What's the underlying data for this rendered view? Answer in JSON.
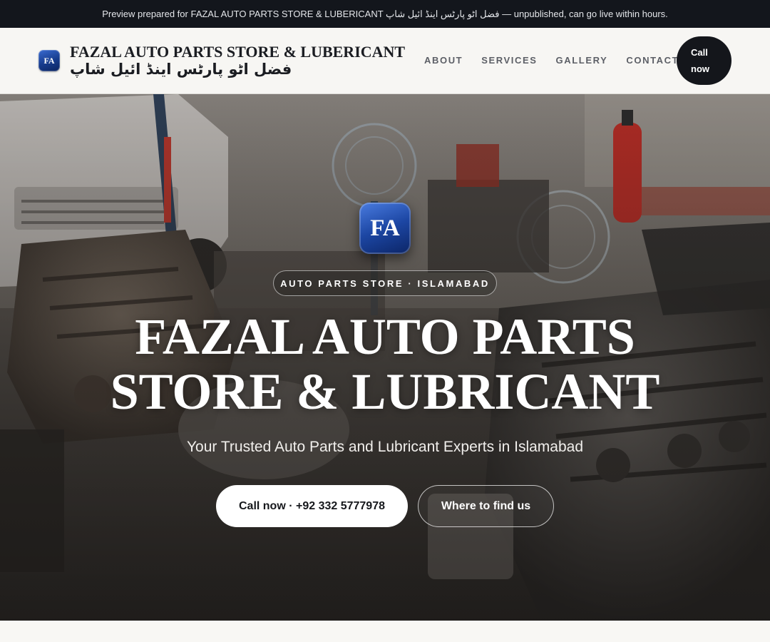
{
  "preview_banner": {
    "text": "Preview prepared for FAZAL AUTO PARTS STORE & LUBERICANT فضل اٹو پارٹس اینڈ ائیل شاپ — unpublished, can go live within hours."
  },
  "header": {
    "logo_initials": "FA",
    "brand_name": "FAZAL AUTO PARTS STORE & LUBERICANT",
    "brand_name_urdu": "فضل اٹو پارٹس اینڈ ائیل شاپ",
    "nav": [
      {
        "label": "ABOUT"
      },
      {
        "label": "SERVICES"
      },
      {
        "label": "GALLERY"
      },
      {
        "label": "CONTACT"
      }
    ],
    "call_button": {
      "line1": "Call",
      "line2": "now"
    }
  },
  "hero": {
    "logo_initials": "FA",
    "tagline": "AUTO PARTS STORE · ISLAMABAD",
    "title_line1": "FAZAL AUTO PARTS",
    "title_line2": "STORE & LUBRICANT",
    "subtitle": "Your Trusted Auto Parts and Lubricant Experts in Islamabad",
    "primary_button": "Call now · +92 332 5777978",
    "secondary_button": "Where to find us"
  },
  "colors": {
    "preview_bar_bg": "#13161c",
    "header_bg": "#f7f6f3",
    "accent_dark": "#14161b",
    "brand_blue": "#1c46a3"
  },
  "icons": {
    "header_logo": "fa-logo-icon",
    "hero_logo": "fa-logo-icon"
  }
}
